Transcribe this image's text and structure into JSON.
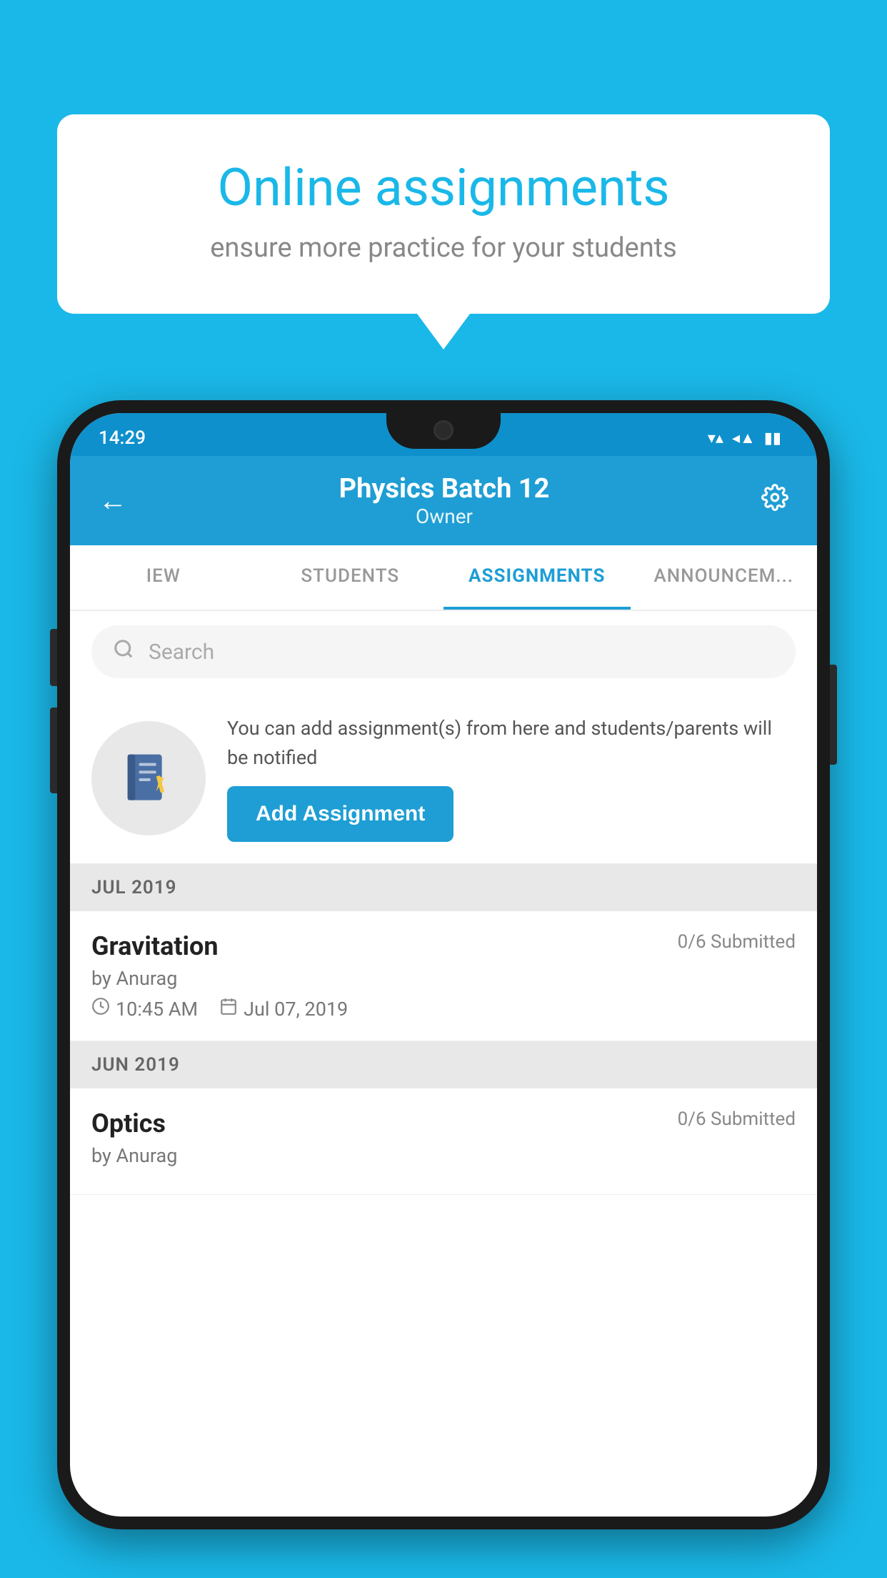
{
  "background_color": "#1ab8e8",
  "speech_bubble": {
    "title": "Online assignments",
    "subtitle": "ensure more practice for your students"
  },
  "status_bar": {
    "time": "14:29",
    "wifi": "▼",
    "signal": "◀",
    "battery": "▮"
  },
  "header": {
    "title": "Physics Batch 12",
    "subtitle": "Owner",
    "back_label": "←",
    "settings_label": "⚙"
  },
  "tabs": [
    {
      "label": "IEW",
      "active": false
    },
    {
      "label": "STUDENTS",
      "active": false
    },
    {
      "label": "ASSIGNMENTS",
      "active": true
    },
    {
      "label": "ANNOUNCEM...",
      "active": false
    }
  ],
  "search": {
    "placeholder": "Search"
  },
  "promo": {
    "text": "You can add assignment(s) from here and students/parents will be notified",
    "button_label": "Add Assignment"
  },
  "sections": [
    {
      "label": "JUL 2019",
      "assignments": [
        {
          "name": "Gravitation",
          "submitted": "0/6 Submitted",
          "by": "by Anurag",
          "time": "10:45 AM",
          "date": "Jul 07, 2019"
        }
      ]
    },
    {
      "label": "JUN 2019",
      "assignments": [
        {
          "name": "Optics",
          "submitted": "0/6 Submitted",
          "by": "by Anurag",
          "time": "",
          "date": ""
        }
      ]
    }
  ]
}
